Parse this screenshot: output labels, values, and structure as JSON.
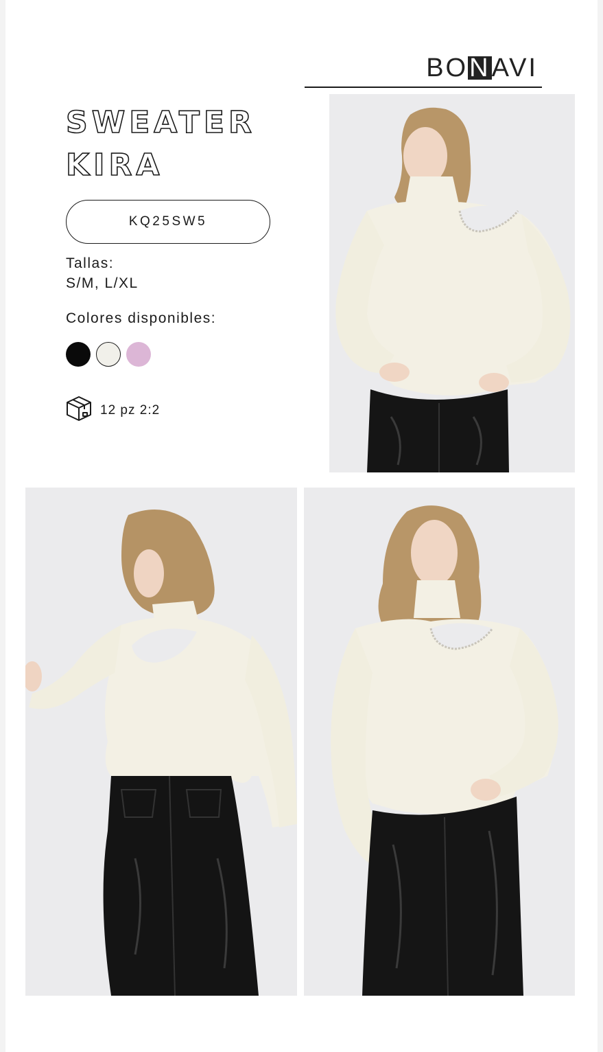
{
  "brand": {
    "logo_text_pre": "BO",
    "logo_text_box": "N",
    "logo_text_post": "AVI"
  },
  "product": {
    "title_line1": "SWEATER",
    "title_line2": "KIRA",
    "sku": "KQ25SW5",
    "sizes_label": "Tallas:",
    "sizes_value": "S/M, L/XL",
    "colors_label": "Colores disponibles:",
    "colors": [
      {
        "name": "black",
        "hex": "#0a0a0a"
      },
      {
        "name": "cream",
        "hex": "#f1f0ea"
      },
      {
        "name": "lilac",
        "hex": "#dcb6d6"
      }
    ],
    "pack_icon": "box-icon",
    "pack_text": "12 pz 2:2"
  },
  "photos": [
    {
      "name": "front-view-photo"
    },
    {
      "name": "back-view-photo"
    },
    {
      "name": "three-quarter-view-photo"
    }
  ]
}
